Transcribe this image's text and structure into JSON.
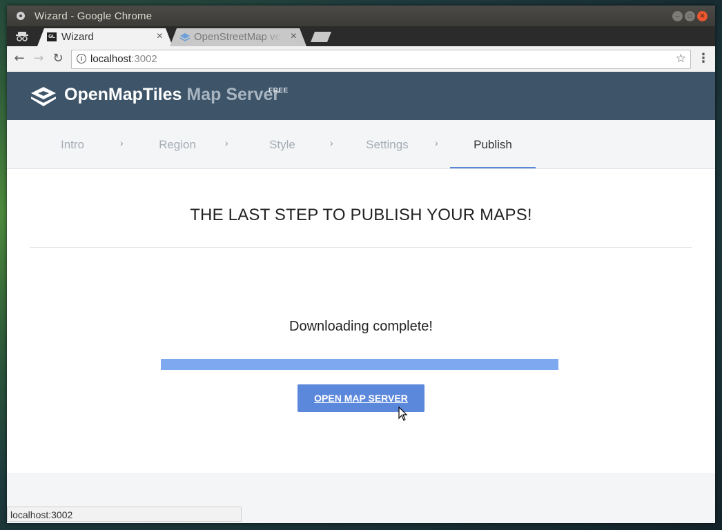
{
  "window": {
    "title": "Wizard - Google Chrome"
  },
  "tabs": [
    {
      "label": "Wizard",
      "favicon": "GL",
      "active": true
    },
    {
      "label": "OpenStreetMap ve",
      "active": false
    }
  ],
  "toolbar": {
    "url_host": "localhost",
    "url_port": ":3002"
  },
  "header": {
    "brand_main": "OpenMapTiles",
    "brand_sub": "Map Server",
    "badge": "FREE",
    "color": "#3e5468"
  },
  "steps": [
    {
      "label": "Intro"
    },
    {
      "label": "Region"
    },
    {
      "label": "Style"
    },
    {
      "label": "Settings"
    },
    {
      "label": "Publish",
      "active": true
    }
  ],
  "main": {
    "heading": "THE LAST STEP TO PUBLISH YOUR MAPS!",
    "status": "Downloading complete!",
    "progress_percent": 100,
    "button_label": "OPEN MAP SERVER",
    "accent": "#5c88dc"
  },
  "statusbar": {
    "text": "localhost:3002"
  }
}
